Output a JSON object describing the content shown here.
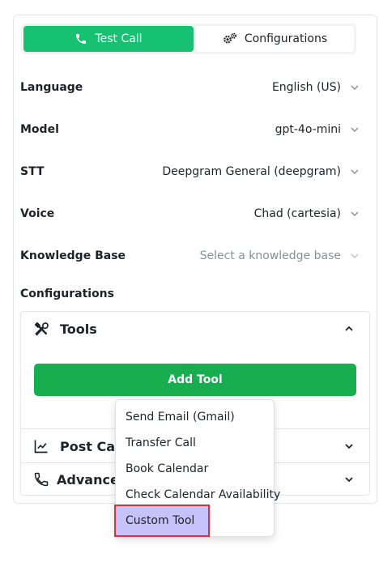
{
  "tabs": {
    "test_call": "Test Call",
    "configurations": "Configurations"
  },
  "settings": [
    {
      "label": "Language",
      "value": "English (US)"
    },
    {
      "label": "Model",
      "value": "gpt-4o-mini"
    },
    {
      "label": "STT",
      "value": "Deepgram General (deepgram)"
    },
    {
      "label": "Voice",
      "value": "Chad (cartesia)"
    },
    {
      "label": "Knowledge Base",
      "placeholder": "Select a knowledge base"
    }
  ],
  "configurations_title": "Configurations",
  "accordion": {
    "tools": {
      "label": "Tools",
      "add_button": "Add Tool"
    },
    "post_call": {
      "label": "Post Call"
    },
    "advance": {
      "label": "Advance S"
    }
  },
  "tool_menu": [
    "Send Email (Gmail)",
    "Transfer Call",
    "Book Calendar",
    "Check Calendar Availability",
    "Custom Tool"
  ],
  "colors": {
    "primary_green": "#16c172",
    "button_green": "#16ae4e",
    "highlight_fill": "#c4c4fb",
    "highlight_border": "#e0302f"
  }
}
